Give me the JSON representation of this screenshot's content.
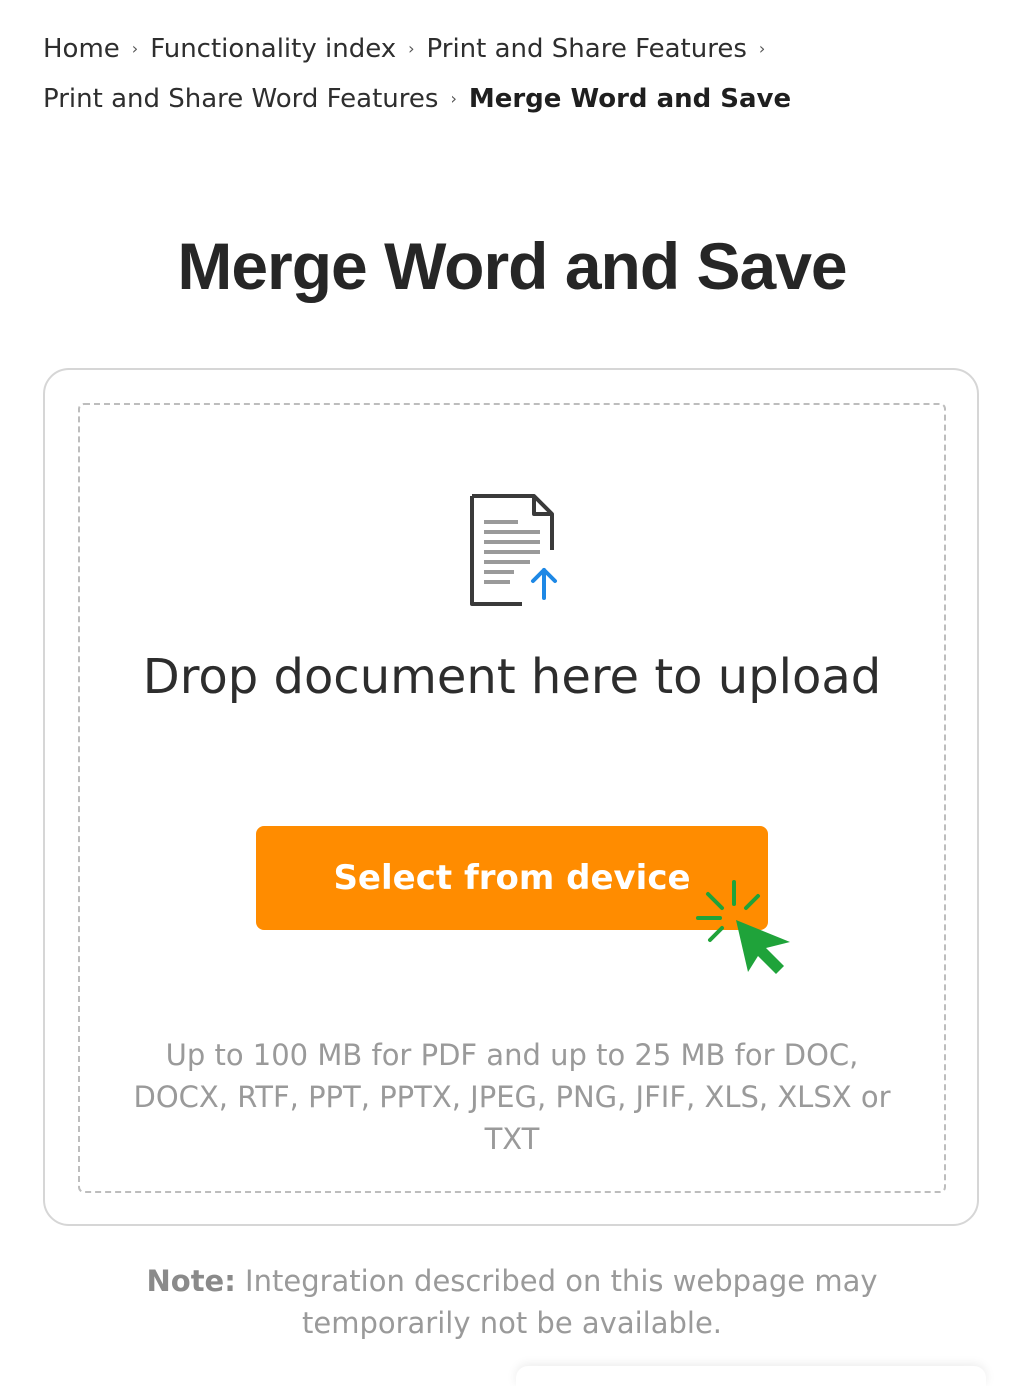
{
  "breadcrumb": {
    "items": [
      "Home",
      "Functionality index",
      "Print and Share Features",
      "Print and Share Word Features"
    ],
    "current": "Merge Word and Save",
    "separator": "›"
  },
  "page": {
    "title": "Merge Word and Save"
  },
  "upload": {
    "drop_text": "Drop document here to upload",
    "button_label": "Select from device",
    "limits_text": "Up to 100 MB for PDF and up to 25 MB for DOC, DOCX, RTF, PPT, PPTX, JPEG, PNG, JFIF, XLS, XLSX or TXT",
    "icon": "document-upload-icon"
  },
  "note": {
    "label": "Note:",
    "text": " Integration described on this webpage may temporarily not be available."
  },
  "colors": {
    "accent": "#ff8c00",
    "upload_arrow": "#1e88e5",
    "cursor": "#1fa33a",
    "text_muted": "#9a9a9a"
  }
}
